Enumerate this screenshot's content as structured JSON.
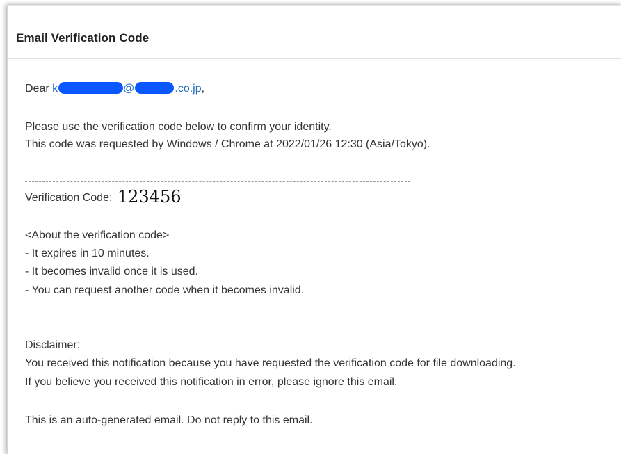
{
  "email": {
    "title": "Email Verification Code",
    "greeting": {
      "salutation": "Dear",
      "email_prefix": "k",
      "at_sign": "@",
      "domain_suffix": ".co.jp",
      "trailing": ","
    },
    "intro_line_1": "Please use the verification code below to confirm your identity.",
    "intro_line_2": "This code was requested by Windows / Chrome at 2022/01/26 12:30 (Asia/Tokyo).",
    "code_label": "Verification Code:",
    "code_value": "123456",
    "about_heading": "<About the verification code>",
    "about_items": [
      "- It expires in 10 minutes.",
      "- It becomes invalid once it is used.",
      "- You can request another code when it becomes invalid."
    ],
    "disclaimer_heading": "Disclaimer:",
    "disclaimer_line_1": "You received this notification because you have requested the verification code for file downloading.",
    "disclaimer_line_2": "If you believe you received this notification in error, please ignore this email.",
    "footer_note": "This is an auto-generated email. Do not reply to this email."
  },
  "colors": {
    "link": "#1f6fbf",
    "redaction": "#0b57ff",
    "text": "#333333"
  }
}
